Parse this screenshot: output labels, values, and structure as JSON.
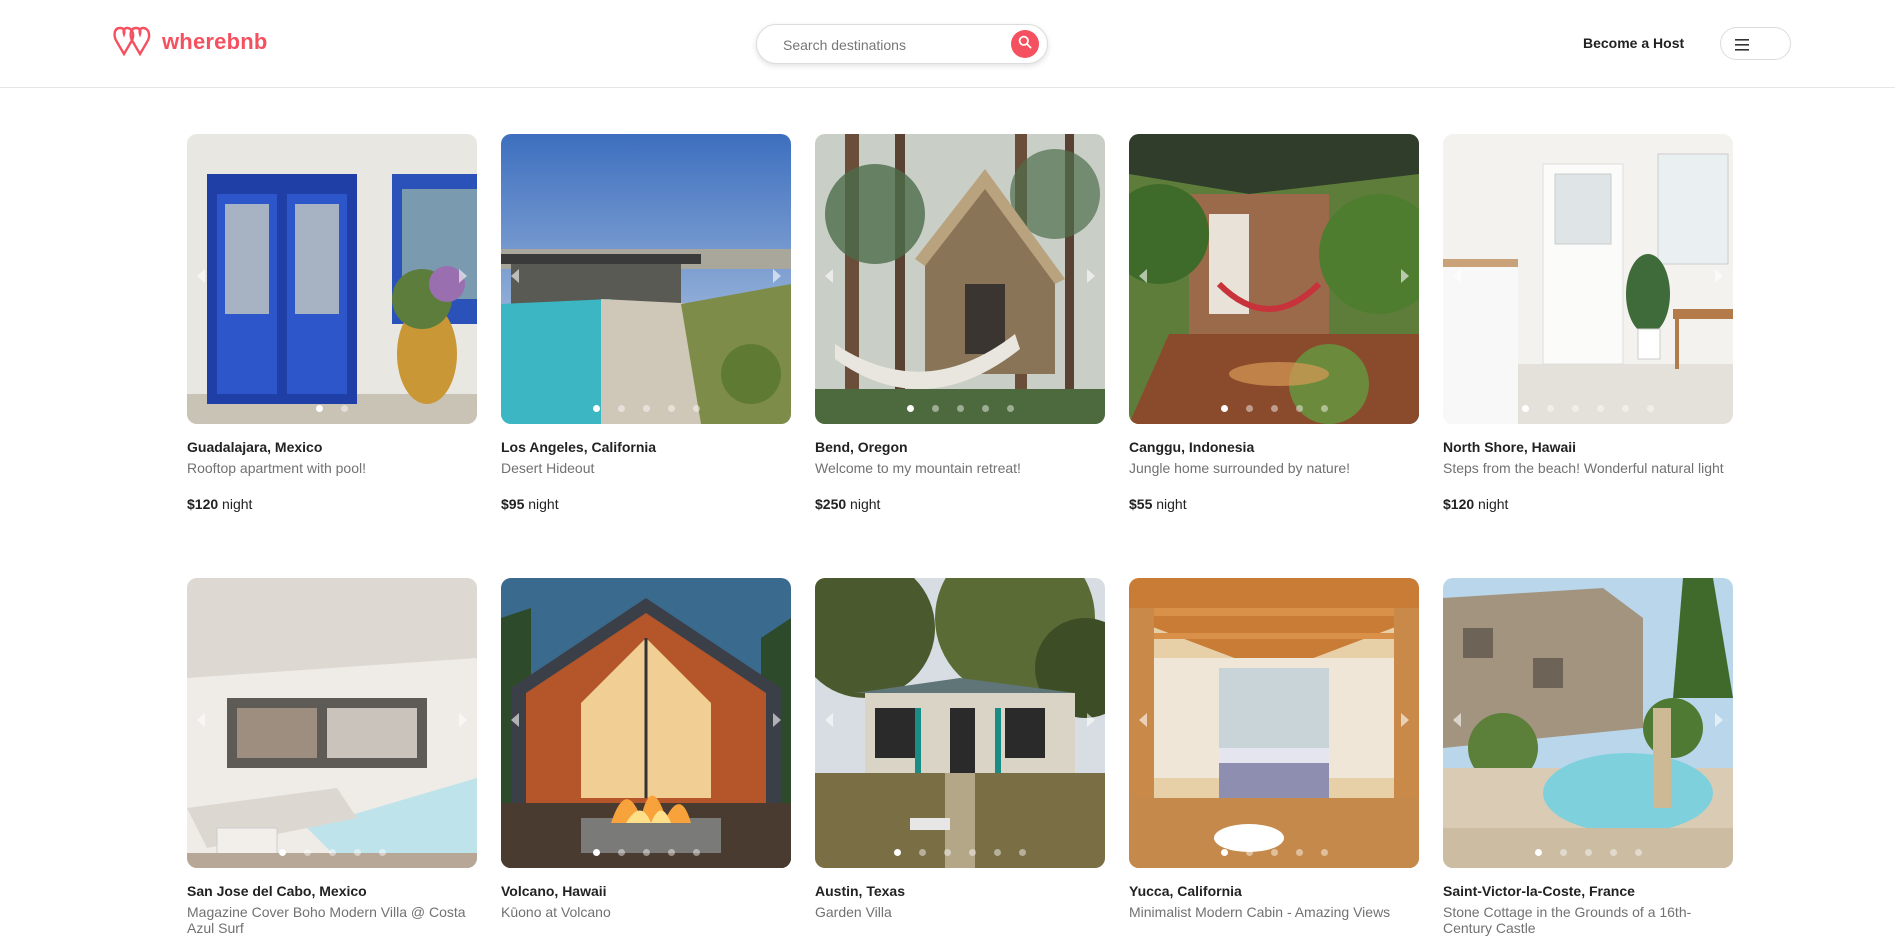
{
  "header": {
    "logo_text": "wherebnb",
    "search": {
      "placeholder": "Search destinations"
    },
    "host_link": "Become a Host"
  },
  "listings": [
    {
      "location": "Guadalajara, Mexico",
      "description": "Rooftop apartment with pool!",
      "price": "$120",
      "unit": " night",
      "dots": 2,
      "active_dot": 0
    },
    {
      "location": "Los Angeles, California",
      "description": "Desert Hideout",
      "price": "$95",
      "unit": " night",
      "dots": 5,
      "active_dot": 0
    },
    {
      "location": "Bend, Oregon",
      "description": "Welcome to my mountain retreat!",
      "price": "$250",
      "unit": " night",
      "dots": 5,
      "active_dot": 0
    },
    {
      "location": "Canggu, Indonesia",
      "description": "Jungle home surrounded by nature!",
      "price": "$55",
      "unit": " night",
      "dots": 5,
      "active_dot": 0
    },
    {
      "location": "North Shore, Hawaii",
      "description": "Steps from the beach! Wonderful natural light",
      "price": "$120",
      "unit": " night",
      "dots": 6,
      "active_dot": 0
    },
    {
      "location": "San Jose del Cabo, Mexico",
      "description": "Magazine Cover Boho Modern Villa @ Costa Azul Surf",
      "price": "",
      "unit": "",
      "dots": 5,
      "active_dot": 0
    },
    {
      "location": "Volcano, Hawaii",
      "description": "Kūono at Volcano",
      "price": "",
      "unit": "",
      "dots": 5,
      "active_dot": 0
    },
    {
      "location": "Austin, Texas",
      "description": "Garden Villa",
      "price": "",
      "unit": "",
      "dots": 6,
      "active_dot": 0
    },
    {
      "location": "Yucca, California",
      "description": "Minimalist Modern Cabin - Amazing Views",
      "price": "",
      "unit": "",
      "dots": 5,
      "active_dot": 0
    },
    {
      "location": "Saint-Victor-la-Coste, France",
      "description": "Stone Cottage in the Grounds of a 16th-Century Castle",
      "price": "",
      "unit": "",
      "dots": 5,
      "active_dot": 0
    }
  ],
  "colors": {
    "brand": "#f5505f"
  },
  "icons": {
    "search": "search-icon",
    "menu": "hamburger-icon",
    "logo": "logo-icon"
  }
}
